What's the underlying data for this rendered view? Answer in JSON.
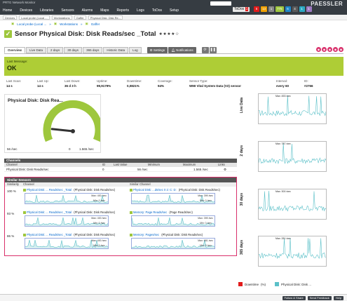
{
  "app": {
    "title": "PRTG Network Monitor",
    "brand": "PAESSLER"
  },
  "menu": [
    "Home",
    "Devices",
    "Libraries",
    "Sensors",
    "Alarms",
    "Maps",
    "Reports",
    "Logs",
    "ToDos",
    "Setup"
  ],
  "todos": "ToDos",
  "todos_count": "1",
  "badges": [
    {
      "text": "5",
      "color": "#e21b1b"
    },
    {
      "text": "13",
      "color": "#f0a000"
    },
    {
      "text": "1",
      "color": "#888888"
    },
    {
      "text": "775",
      "color": "#9ec73d"
    },
    {
      "text": "6",
      "color": "#1e87c9"
    },
    {
      "text": "4",
      "color": "#5a5a5a"
    },
    {
      "text": "1",
      "color": "#2ba8c2"
    },
    {
      "text": "1",
      "color": "#9e7ac2"
    }
  ],
  "breadcrumbs": [
    "Devices",
    "Local probe (Local ...",
    "Workstations",
    "Gaffer",
    "Physical Disk: Disk Re..."
  ],
  "subnav": [
    "Local probe (Local ...",
    "Workstations",
    "Gaffer"
  ],
  "sensor": {
    "title": "Sensor Physical Disk: Disk Reads/sec _Total",
    "stars": "★★★★☆"
  },
  "tabs": [
    "Overview",
    "Live Data",
    "2 days",
    "30 days",
    "365 days",
    "Historic Data",
    "Log"
  ],
  "tool_buttons": [
    "Settings",
    "Notifications"
  ],
  "status": {
    "label": "Last Message:",
    "value": "OK"
  },
  "stats": [
    {
      "k": "Last Scan:",
      "v": "14 s"
    },
    {
      "k": "Last Up:",
      "v": "14 s"
    },
    {
      "k": "Last Down:",
      "v": "36 d 3 h"
    },
    {
      "k": "Uptime:",
      "v": "99,9179%"
    },
    {
      "k": "Downtime:",
      "v": "0,0821%"
    },
    {
      "k": "Coverage:",
      "v": "94%"
    },
    {
      "k": "Sensor Type:",
      "v": "WMI Vital System Data (V2) sensor"
    },
    {
      "k": "Interval:",
      "v": "every 60"
    },
    {
      "k": "ID:",
      "v": "#2766"
    }
  ],
  "gauge": {
    "title": "Physical Disk: Disk Rea...",
    "min_label": "0",
    "max_label": "1.565 /sec",
    "left_label": "56 /sec",
    "value_fraction": 0.15
  },
  "channels": {
    "title": "Channels",
    "headers": [
      "Channel",
      "ID",
      "Last Value",
      "Minimum",
      "Maximum",
      "Links"
    ],
    "rows": [
      [
        "Physical Disk: Disk Reads/sec",
        "0",
        "",
        "56 /sec",
        "1.565 /sec",
        ""
      ]
    ]
  },
  "similar": {
    "title": "Similar Sensors",
    "headers": [
      "Similarity",
      "Channel",
      "Similar Channel"
    ],
    "rows": [
      {
        "pct": "100 %",
        "a": "Physical Disk: ... Reads/sec _Total",
        "a2": "(Physical Disk: Disk Reads/sec)",
        "a_max": "Max: 400 /sec",
        "a_min": "Min: 0 /sec",
        "b": "Physical Disk: ...ds/sec 0 2: C: D:",
        "b2": "(Physical Disk: Disk Reads/sec)",
        "b_max": "Max: 399 /sec",
        "b_min": "Min: 0 /sec"
      },
      {
        "pct": "93 %",
        "a": "Physical Disk: ... Reads/sec _Total",
        "a2": "(Physical Disk: Disk Reads/sec)",
        "a_max": "Max: 400 /sec",
        "a_min": "Min: 0 /sec",
        "b": "Memory: Page Reads/sec",
        "b2": "(Page Reads/sec)",
        "b_max": "Max: 399 /sec",
        "b_min": "Min: 0 /sec"
      },
      {
        "pct": "86 %",
        "a": "Physical Disk: ... Reads/sec _Total",
        "a2": "(Physical Disk: Disk Reads/sec)",
        "a_max": "Max: 400 /sec",
        "a_min": "Min: 0 /sec",
        "b": "Memory: Pages/sec",
        "b2": "(Physical Disk: Disk Reads/sec)",
        "b_max": "Max: 681 /sec",
        "b_min": "Min: 0 /sec"
      }
    ]
  },
  "right_charts": [
    {
      "label": "Live Data",
      "max": "Max: 453 /sec"
    },
    {
      "label": "2 days",
      "max": "Max: 787 /sec"
    },
    {
      "label": "30 days",
      "max": "Max: 300 /sec"
    },
    {
      "label": "365 days",
      "max": "Max: 281 /sec"
    }
  ],
  "legend": {
    "a": "Downtime",
    "a_unit": "(%)",
    "b": "Physical Disk: Disk ..."
  },
  "footer": [
    "Follow & Share",
    "Send Feedback",
    "Help"
  ],
  "colors": {
    "ok": "#aecd36",
    "down": "#e21b1b",
    "line": "#5bc0c8",
    "accent": "#d9306b"
  }
}
